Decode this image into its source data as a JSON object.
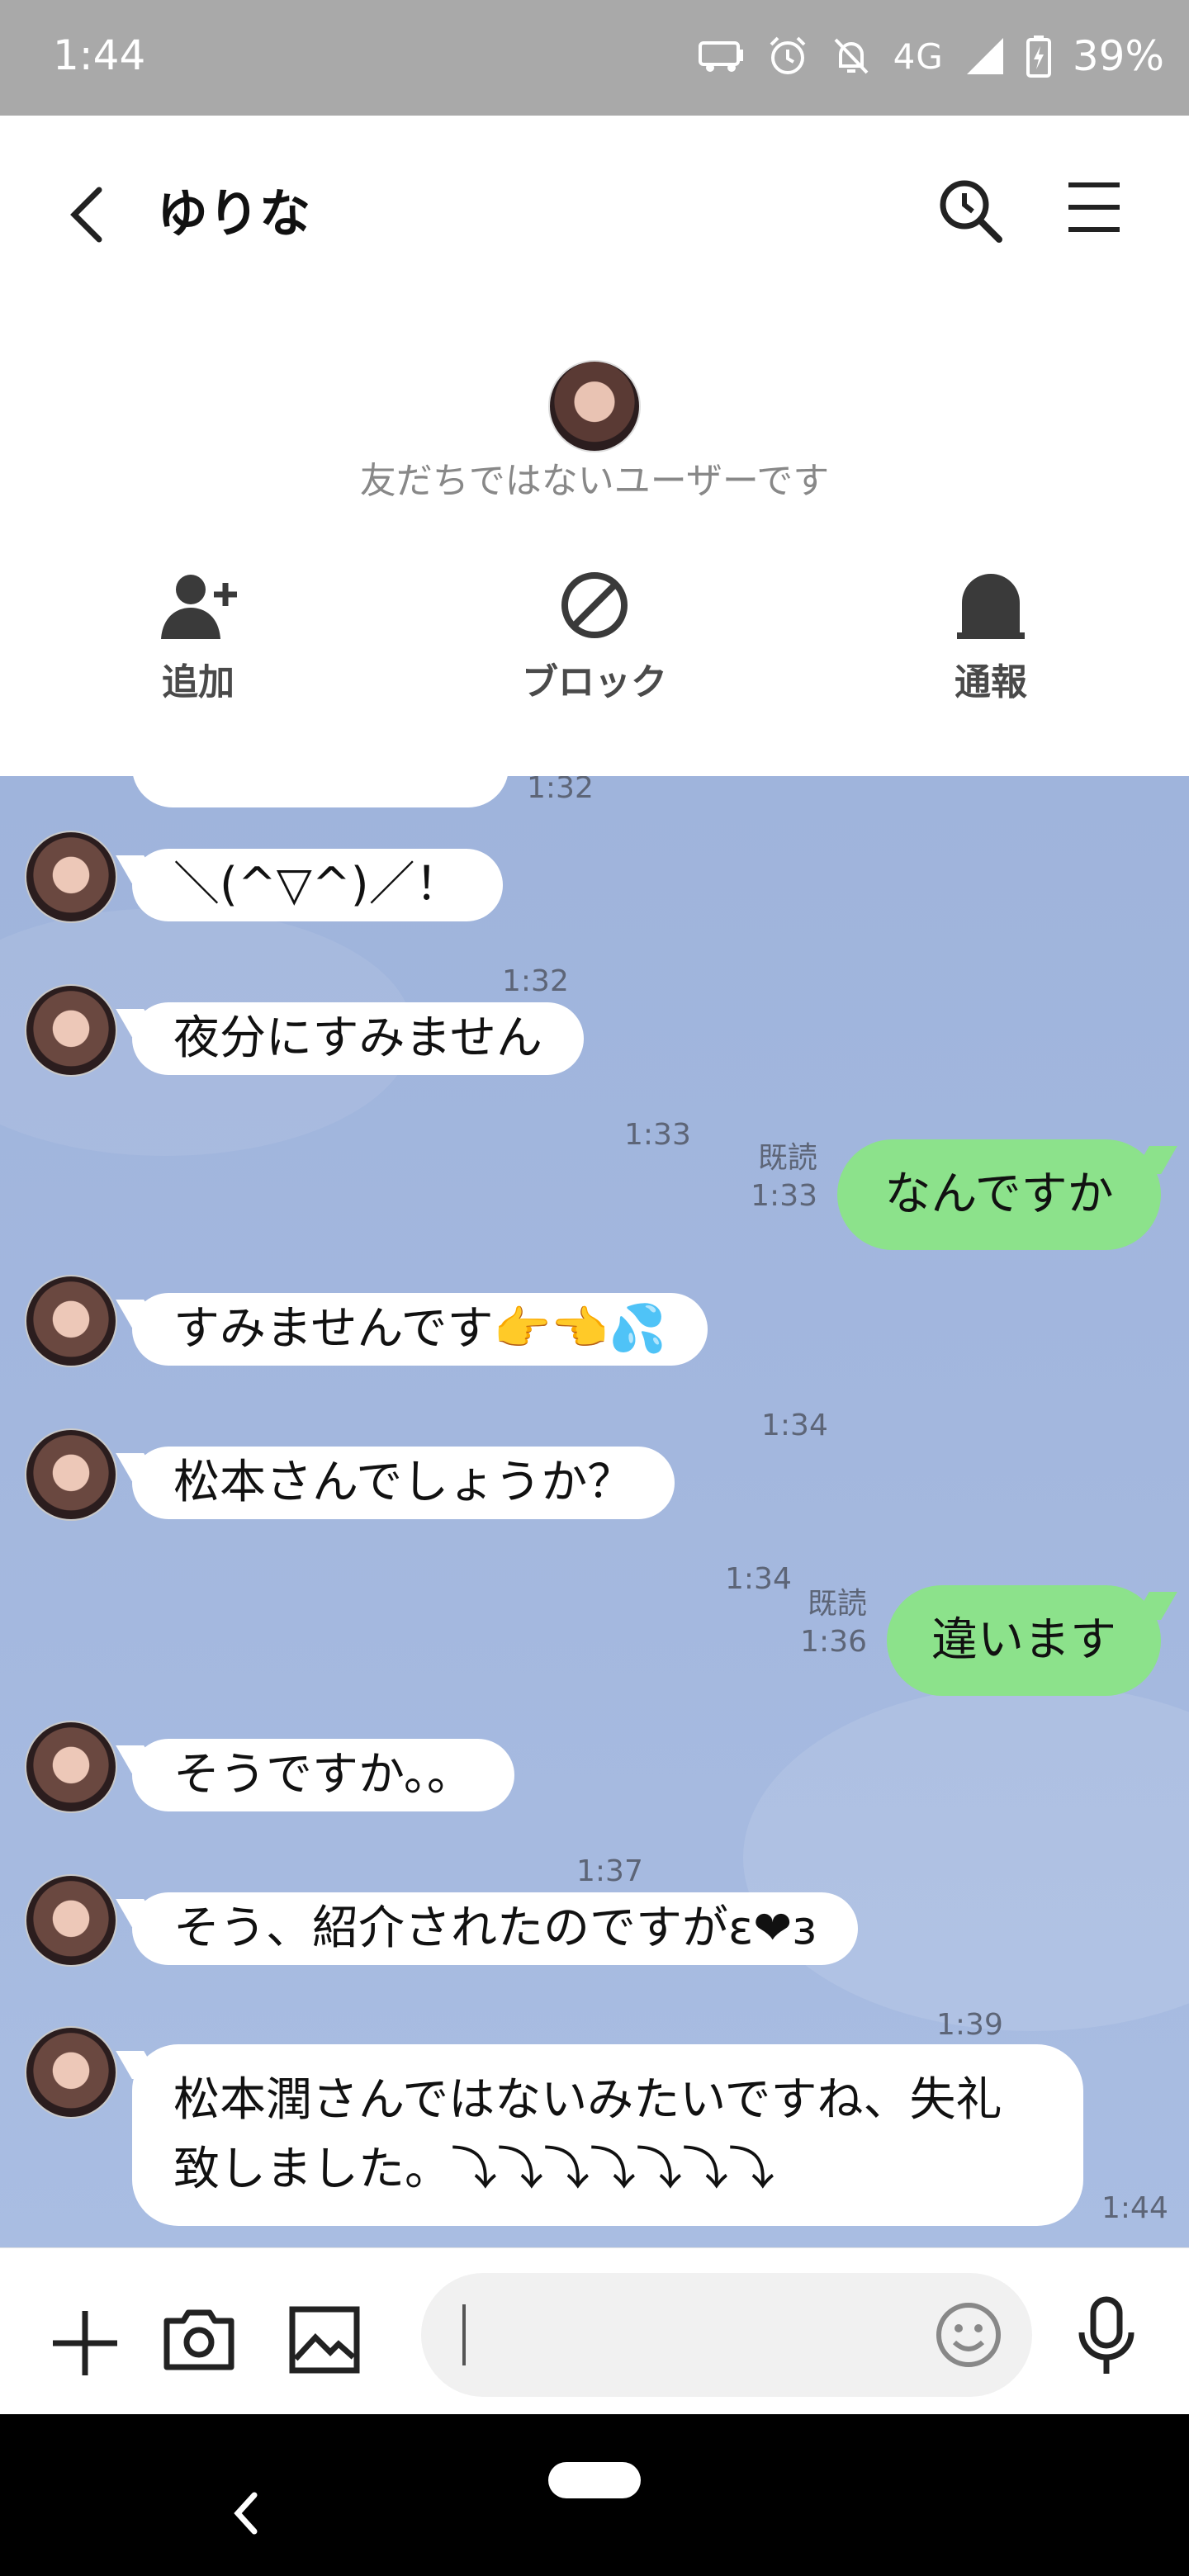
{
  "status_bar": {
    "time": "1:44",
    "network": "4G",
    "battery": "39%"
  },
  "header": {
    "title": "ゆりな"
  },
  "profile": {
    "notice": "友だちではないユーザーです",
    "actions": {
      "add": "追加",
      "block": "ブロック",
      "report": "通報"
    }
  },
  "messages": [
    {
      "side": "left",
      "text": "",
      "time": "1:32"
    },
    {
      "side": "left",
      "text": "＼(^▽^)／！",
      "time": "1:32"
    },
    {
      "side": "left",
      "text": "夜分にすみません",
      "time": "1:33"
    },
    {
      "side": "right",
      "text": "なんですか",
      "read": "既読",
      "time": "1:33"
    },
    {
      "side": "left",
      "text": "すみませんです👉👈💦",
      "time": "1:34"
    },
    {
      "side": "left",
      "text": "松本さんでしょうか？",
      "time": "1:34"
    },
    {
      "side": "right",
      "text": "違います",
      "read": "既読",
      "time": "1:36"
    },
    {
      "side": "left",
      "text": "そうですか。。",
      "time": "1:37"
    },
    {
      "side": "left",
      "text": "そう、紹介されたのですがε❤з",
      "time": "1:39"
    },
    {
      "side": "left",
      "text": "松本潤さんではないみたいですね、失礼致しました。⤵⤵⤵⤵⤵⤵⤵",
      "time": "1:44"
    }
  ],
  "composer": {
    "placeholder": ""
  },
  "colors": {
    "chat_bg": "#a3b7de",
    "my_bubble": "#8ce28b",
    "status_bar": "#a9a9a9"
  }
}
